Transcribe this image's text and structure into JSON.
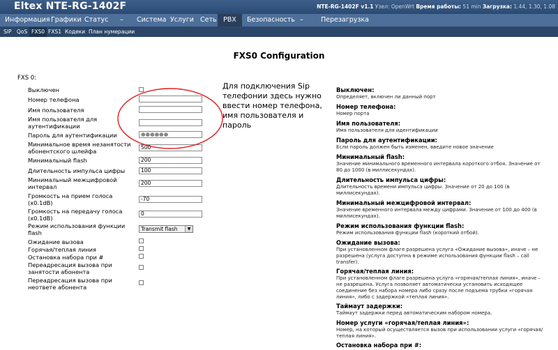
{
  "header": {
    "brand": "Eltex NTE-RG-1402F",
    "info_model": "NTE-RG-1402F v1.1",
    "info_node_label": "Узел:",
    "info_node": "OpenWrt",
    "info_uptime_label": "Время работы:",
    "info_uptime": "51 min",
    "info_load_label": "Загрузка:",
    "info_load": "1.44, 1.30, 1.08"
  },
  "main_menu": [
    "Информация",
    "Графики",
    "Статус",
    "–",
    "Система",
    "Услуги",
    "Сеть",
    "PBX",
    "Безопасность",
    "–",
    "Перезагрузка"
  ],
  "sub_menu": [
    "SIP",
    "QoS",
    "FXS0",
    "FXS1",
    "Кодеки",
    "План нумерации"
  ],
  "page": {
    "title": "FXS0 Configuration",
    "section": "FXS 0:"
  },
  "form": {
    "disabled": "Выключен",
    "phone": "Номер телефона",
    "user": "Имя пользователя",
    "auth_user": "Имя пользователя для аутентификации",
    "auth_pass": "Пароль для аутентификации",
    "auth_pass_value": "●●●●●●",
    "min_onhook": "Минимальное время незанятости абонентского шлейфа",
    "min_onhook_value": "500",
    "min_flash": "Минимальный flash",
    "min_flash_value": "200",
    "pulse": "Длительность импульса цифры",
    "pulse_value": "100",
    "interdigit": "Минимальный межцифровой интервал",
    "interdigit_value": "200",
    "rx_gain": "Громкость на прием голоса (x0.1dB)",
    "rx_gain_value": "-70",
    "tx_gain": "Громкость на передачу голоса (x0.1dB)",
    "tx_gain_value": "0",
    "flash_mode": "Режим использования функции flash",
    "flash_mode_value": "Transmit flash",
    "call_waiting": "Ожидание вызова",
    "hotline": "Горячая/теплая линия",
    "stop_dial": "Остановка набора при #",
    "fwd_busy": "Переадресация вызова при занятости абонента",
    "fwd_noanswer": "Переадресация вызова при неответе абонента"
  },
  "annotation": "Для подключения Sip телефонии здесь нужно ввести номер телефона, имя пользователя и пароль",
  "help": [
    {
      "h": "Выключен:",
      "d": "Определяет, включен ли данный порт"
    },
    {
      "h": "Номер телефона:",
      "d": "Номер порта"
    },
    {
      "h": "Имя пользователя:",
      "d": "Имя пользователя для идентификации"
    },
    {
      "h": "Пароль для аутентификации:",
      "d": "Если пароль должен быть изменен, введите новое значение"
    },
    {
      "h": "Минимальный flash:",
      "d": "Значение минимального временного интервала короткого отбоя. Значение от 80 до 1000 (в миллисекундах)."
    },
    {
      "h": "Длительность импульса цифры:",
      "d": "Длительность времени импульса цифры. Значение от 20 до 100 (в миллисекундах)."
    },
    {
      "h": "Минимальный межцифровой интервал:",
      "d": "Значение временного интервала между цифрами. Значение от 100 до 400 (в миллисекундах)."
    },
    {
      "h": "Режим использования функции flash:",
      "d": "Режим использования функции flash (короткий отбой)."
    },
    {
      "h": "Ожидание вызова:",
      "d": "При установленном флаге разрешена услуга «Ожидание вызова», иначе – не разрешена (услуга доступна в режиме использования функции flash – call transfer)."
    },
    {
      "h": "Горячая/теплая линия:",
      "d": "При установленном флаге разрешена услуга «горячая/теплая линия», иначе – не разрешена. Услуга позволяет автоматически установить исходящее соединение без набора номера либо сразу после подъема трубки «горячая линия», либо с задержкой «теплая линия»."
    },
    {
      "h": "Таймаут задержки:",
      "d": "Таймаут задержки перед автоматическим набором номера."
    },
    {
      "h": "Номер услуги «горячая/теплая линия»:",
      "d": "Номер, на который осуществляется вызов при использовании услуги «горячая/теплая линия»."
    },
    {
      "h": "Остановка набора при #:",
      "d": ""
    }
  ]
}
